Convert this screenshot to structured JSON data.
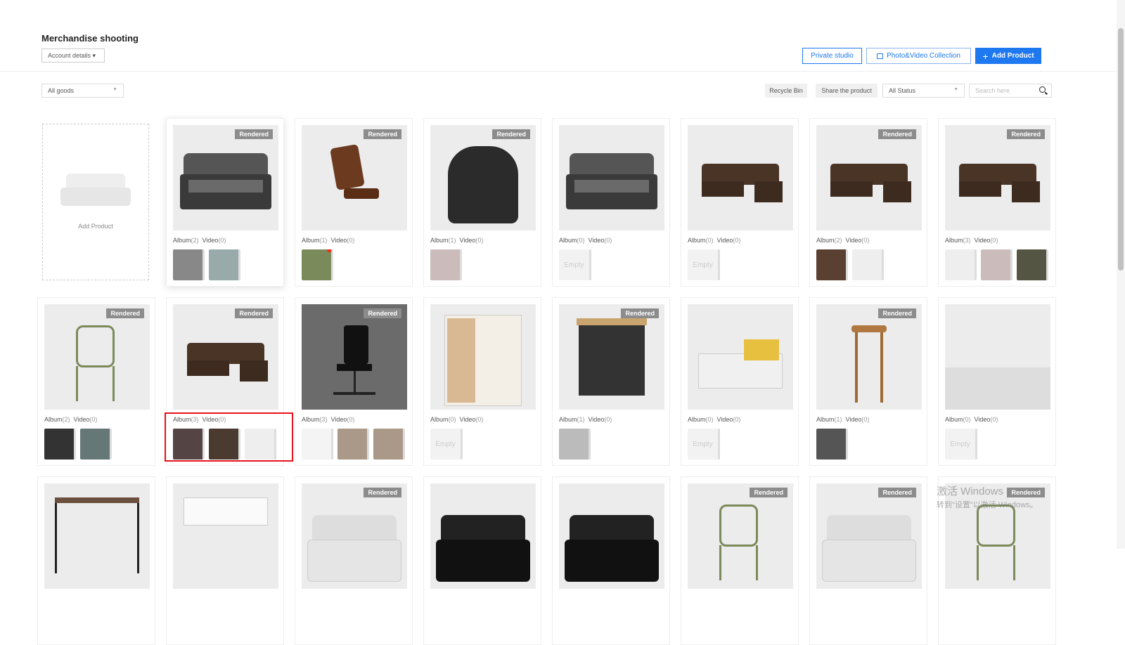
{
  "header": {
    "title": "Merchandise shooting",
    "account": "Account details ▾",
    "private_studio": "Private studio",
    "collection": "Photo&Video Collection",
    "add_product": "Add Product"
  },
  "toolbar": {
    "filter": "All goods",
    "recycle": "Recycle Bin",
    "share": "Share the product",
    "status": "All Status",
    "search_placeholder": "Search here"
  },
  "add_card": {
    "label": "Add Product"
  },
  "labels": {
    "album": "Album",
    "video": "Video",
    "rendered": "Rendered",
    "empty": "Empty"
  },
  "products": [
    {
      "kind": "sofa-grey",
      "rendered": true,
      "album": 2,
      "video": 0,
      "thumbs": [
        "#888",
        "#9aa"
      ]
    },
    {
      "kind": "chair-leather",
      "rendered": true,
      "album": 1,
      "video": 0,
      "thumbs": [
        "#7a8a5a"
      ],
      "dot": true
    },
    {
      "kind": "armchair-black",
      "rendered": true,
      "album": 1,
      "video": 0,
      "thumbs": [
        "#cbb"
      ]
    },
    {
      "kind": "sofa-grey",
      "rendered": false,
      "album": 0,
      "video": 0,
      "thumbs": []
    },
    {
      "kind": "sectional",
      "rendered": false,
      "album": 0,
      "video": 0,
      "thumbs": []
    },
    {
      "kind": "sectional",
      "rendered": true,
      "album": 2,
      "video": 0,
      "thumbs": [
        "#5a4030",
        "#eee"
      ]
    },
    {
      "kind": "sectional",
      "rendered": true,
      "album": 3,
      "video": 0,
      "thumbs": [
        "#eee",
        "#cbb",
        "#554"
      ]
    },
    {
      "kind": "chair-green",
      "rendered": true,
      "album": 2,
      "video": 0,
      "thumbs": [
        "#333",
        "#677"
      ]
    },
    {
      "kind": "sectional",
      "rendered": true,
      "album": 3,
      "video": 0,
      "thumbs": [
        "#544",
        "#4a3a30",
        "#eee"
      ]
    },
    {
      "kind": "office-chair",
      "rendered": true,
      "album": 3,
      "video": 0,
      "thumbs": [
        "#f4f4f4",
        "#a98",
        "#a98"
      ]
    },
    {
      "kind": "cabinet",
      "rendered": false,
      "album": 0,
      "video": 0,
      "thumbs": []
    },
    {
      "kind": "cart",
      "rendered": true,
      "album": 1,
      "video": 0,
      "thumbs": [
        "#bbb"
      ]
    },
    {
      "kind": "counter",
      "rendered": false,
      "album": 0,
      "video": 0,
      "thumbs": []
    },
    {
      "kind": "stool",
      "rendered": true,
      "album": 1,
      "video": 0,
      "thumbs": [
        "#555"
      ]
    },
    {
      "kind": "room",
      "rendered": false,
      "album": 0,
      "video": 0,
      "thumbs": []
    },
    {
      "kind": "desk",
      "rendered": false
    },
    {
      "kind": "desk-white",
      "rendered": false
    },
    {
      "kind": "sofa-white",
      "rendered": true
    },
    {
      "kind": "sofa-black",
      "rendered": false
    },
    {
      "kind": "sofa-black",
      "rendered": false
    },
    {
      "kind": "chair-green",
      "rendered": true
    },
    {
      "kind": "sofa-white",
      "rendered": true
    },
    {
      "kind": "chair-green",
      "rendered": true
    }
  ],
  "watermark": {
    "line1": "激活 Windows",
    "line2": "转到\"设置\"以激活 Windows。"
  }
}
